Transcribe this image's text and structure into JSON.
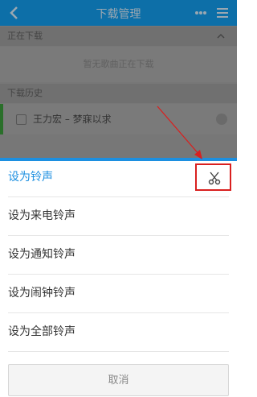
{
  "background": {
    "title": "下载管理",
    "section_downloading": "正在下载",
    "empty_text": "暂无歌曲正在下载",
    "section_history": "下载历史",
    "history_item": "王力宏 – 梦寐以求"
  },
  "menu": {
    "items": [
      {
        "label": "设为铃声"
      },
      {
        "label": "设为来电铃声"
      },
      {
        "label": "设为通知铃声"
      },
      {
        "label": "设为闹钟铃声"
      },
      {
        "label": "设为全部铃声"
      }
    ],
    "cancel_label": "取消"
  },
  "colors": {
    "accent": "#1c8fe0",
    "highlight_box": "#d9201f"
  }
}
